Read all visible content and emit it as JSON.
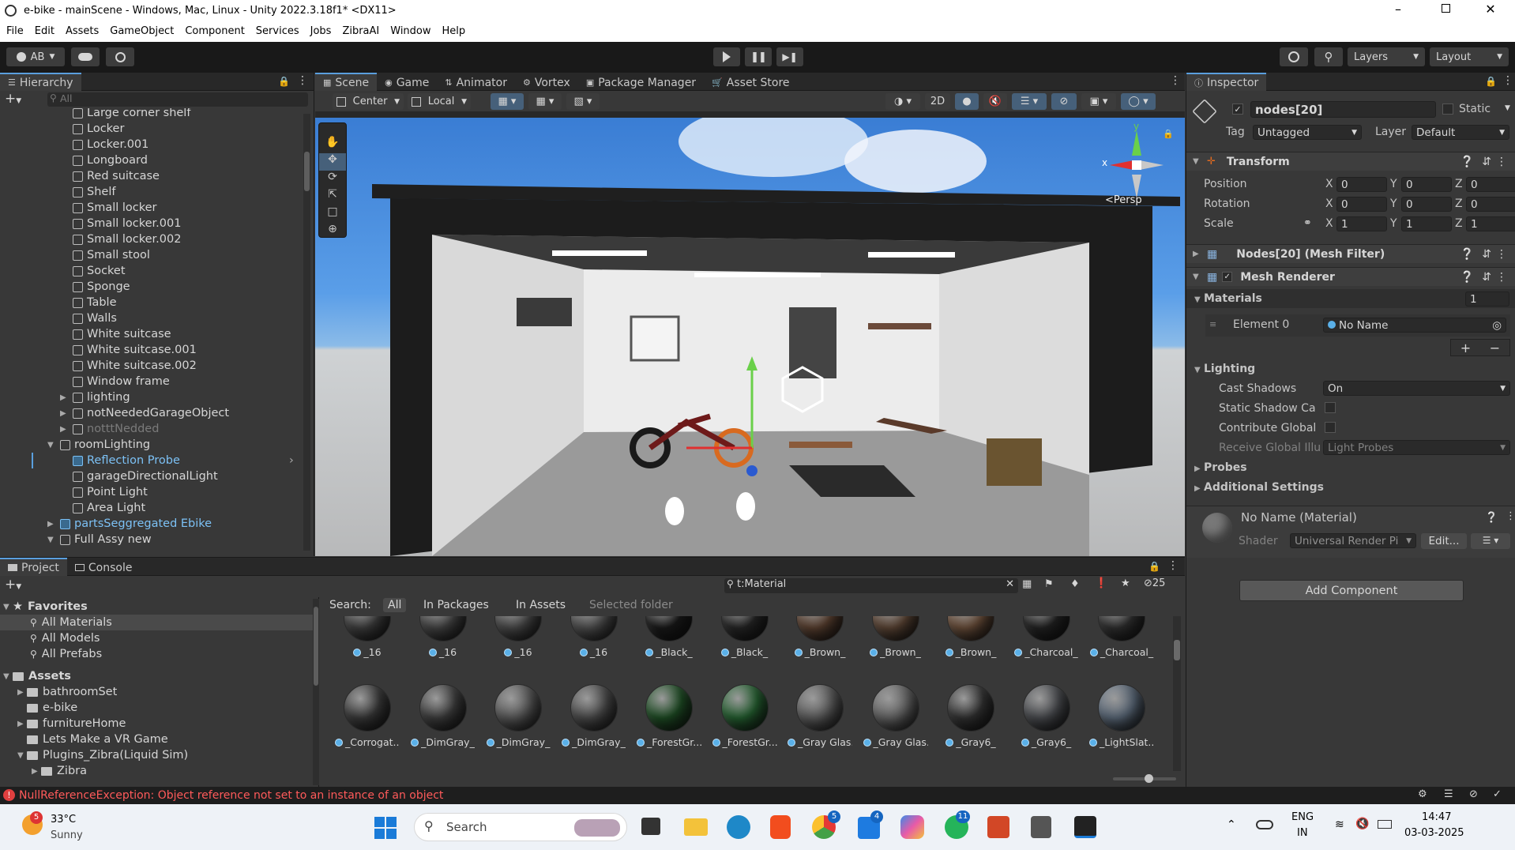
{
  "titlebar": {
    "title": "e-bike - mainScene - Windows, Mac, Linux - Unity 2022.3.18f1* <DX11>"
  },
  "menu": [
    "File",
    "Edit",
    "Assets",
    "GameObject",
    "Component",
    "Services",
    "Jobs",
    "ZibraAI",
    "Window",
    "Help"
  ],
  "toolbar": {
    "account": "AB",
    "layers": "Layers",
    "layout": "Layout"
  },
  "hierarchy": {
    "tab": "Hierarchy",
    "search_placeholder": "All",
    "items": [
      {
        "label": "Large corner shelf",
        "indent": 1,
        "type": "object",
        "state": "normal"
      },
      {
        "label": "Locker",
        "indent": 1,
        "type": "object",
        "state": "normal"
      },
      {
        "label": "Locker.001",
        "indent": 1,
        "type": "object",
        "state": "normal"
      },
      {
        "label": "Longboard",
        "indent": 1,
        "type": "object",
        "state": "normal"
      },
      {
        "label": "Red suitcase",
        "indent": 1,
        "type": "object",
        "state": "normal"
      },
      {
        "label": "Shelf",
        "indent": 1,
        "type": "object",
        "state": "normal"
      },
      {
        "label": "Small locker",
        "indent": 1,
        "type": "object",
        "state": "normal"
      },
      {
        "label": "Small locker.001",
        "indent": 1,
        "type": "object",
        "state": "normal"
      },
      {
        "label": "Small locker.002",
        "indent": 1,
        "type": "object",
        "state": "normal"
      },
      {
        "label": "Small stool",
        "indent": 1,
        "type": "object",
        "state": "normal"
      },
      {
        "label": "Socket",
        "indent": 1,
        "type": "object",
        "state": "normal"
      },
      {
        "label": "Sponge",
        "indent": 1,
        "type": "object",
        "state": "normal"
      },
      {
        "label": "Table",
        "indent": 1,
        "type": "object",
        "state": "normal"
      },
      {
        "label": "Walls",
        "indent": 1,
        "type": "object",
        "state": "normal"
      },
      {
        "label": "White suitcase",
        "indent": 1,
        "type": "object",
        "state": "normal"
      },
      {
        "label": "White suitcase.001",
        "indent": 1,
        "type": "object",
        "state": "normal"
      },
      {
        "label": "White suitcase.002",
        "indent": 1,
        "type": "object",
        "state": "normal"
      },
      {
        "label": "Window frame",
        "indent": 1,
        "type": "object",
        "state": "normal"
      },
      {
        "label": "lighting",
        "indent": 1,
        "type": "object",
        "state": "collapsed"
      },
      {
        "label": "notNeededGarageObject",
        "indent": 1,
        "type": "object",
        "state": "collapsed"
      },
      {
        "label": "notttNedded",
        "indent": 1,
        "type": "object",
        "state": "disabled"
      },
      {
        "label": "roomLighting",
        "indent": 0,
        "type": "object",
        "state": "expanded"
      },
      {
        "label": "Reflection Probe",
        "indent": 1,
        "type": "prefab",
        "state": "prefab"
      },
      {
        "label": "garageDirectionalLight",
        "indent": 1,
        "type": "object",
        "state": "normal"
      },
      {
        "label": "Point Light",
        "indent": 1,
        "type": "object",
        "state": "normal"
      },
      {
        "label": "Area Light",
        "indent": 1,
        "type": "object",
        "state": "normal"
      },
      {
        "label": "partsSeggregated Ebike",
        "indent": 0,
        "type": "prefab",
        "state": "prefab-collapsed"
      },
      {
        "label": "Full Assy new",
        "indent": 0,
        "type": "object",
        "state": "expanded"
      }
    ]
  },
  "scene": {
    "tabs": [
      "Scene",
      "Game",
      "Animator",
      "Vortex",
      "Package Manager",
      "Asset Store"
    ],
    "pivot": "Center",
    "space": "Local",
    "mode_2d": "2D",
    "persp_label": "<Persp",
    "gizmo_axes": {
      "x": "x",
      "y": "y"
    }
  },
  "inspector": {
    "tab": "Inspector",
    "object_name": "nodes[20]",
    "static_label": "Static",
    "tag_label": "Tag",
    "tag_value": "Untagged",
    "layer_label": "Layer",
    "layer_value": "Default",
    "transform": {
      "title": "Transform",
      "rows": [
        {
          "label": "Position",
          "x": "0",
          "y": "0",
          "z": "0"
        },
        {
          "label": "Rotation",
          "x": "0",
          "y": "0",
          "z": "0"
        },
        {
          "label": "Scale",
          "x": "1",
          "y": "1",
          "z": "1"
        }
      ]
    },
    "mesh_filter": "Nodes[20] (Mesh Filter)",
    "mesh_renderer": "Mesh Renderer",
    "materials_label": "Materials",
    "materials_count": "1",
    "element0_label": "Element 0",
    "element0_value": "No Name",
    "lighting_label": "Lighting",
    "cast_shadows_label": "Cast Shadows",
    "cast_shadows_value": "On",
    "static_shadow_label": "Static Shadow Ca",
    "contribute_global_label": "Contribute Global",
    "receive_gi_label": "Receive Global Illu",
    "receive_gi_value": "Light Probes",
    "probes_label": "Probes",
    "additional_label": "Additional Settings",
    "material_name": "No Name (Material)",
    "shader_label": "Shader",
    "shader_value": "Universal Render Pi",
    "edit_button": "Edit...",
    "add_component": "Add Component"
  },
  "project": {
    "tabs": [
      "Project",
      "Console"
    ],
    "search_value": "t:Material",
    "hidden_count": "25",
    "search_label": "Search:",
    "scopes": [
      "All",
      "In Packages",
      "In Assets",
      "Selected folder"
    ],
    "favorites_label": "Favorites",
    "favorites": [
      "All Materials",
      "All Models",
      "All Prefabs"
    ],
    "assets_label": "Assets",
    "folders": [
      "bathroomSet",
      "e-bike",
      "furnitureHome",
      "Lets Make a VR Game",
      "Plugins_Zibra(Liquid Sim)",
      "Zibra"
    ],
    "materials_row1": [
      {
        "label": "_16",
        "color": "#3f3f3f"
      },
      {
        "label": "_16",
        "color": "#454545"
      },
      {
        "label": "_16",
        "color": "#4a4a4a"
      },
      {
        "label": "_16",
        "color": "#505050"
      },
      {
        "label": "_Black_",
        "color": "#1a1a1a"
      },
      {
        "label": "_Black_",
        "color": "#262626"
      },
      {
        "label": "_Brown_",
        "color": "#5a4030"
      },
      {
        "label": "_Brown_",
        "color": "#5c4535"
      },
      {
        "label": "_Brown_",
        "color": "#6a4e3a"
      },
      {
        "label": "_Charcoal_",
        "color": "#232323"
      },
      {
        "label": "_Charcoal_",
        "color": "#303030"
      }
    ],
    "materials_row2": [
      {
        "label": "_Corrogat...",
        "color": "#3a3a3a"
      },
      {
        "label": "_DimGray_",
        "color": "#3e3e3e"
      },
      {
        "label": "_DimGray_",
        "color": "#5a5a5a"
      },
      {
        "label": "_DimGray_",
        "color": "#4c4c4c"
      },
      {
        "label": "_ForestGr...",
        "color": "#1e4d24"
      },
      {
        "label": "_ForestGr...",
        "color": "#246030"
      },
      {
        "label": "_Gray Glas...",
        "color": "#5e5e5e"
      },
      {
        "label": "_Gray Glas...",
        "color": "#666"
      },
      {
        "label": "_Gray6_",
        "color": "#333"
      },
      {
        "label": "_Gray6_",
        "color": "#4a4c50"
      },
      {
        "label": "_LightSlat...",
        "color": "#5a6878"
      }
    ]
  },
  "status": {
    "error": "NullReferenceException: Object reference not set to an instance of an object"
  },
  "taskbar": {
    "temp": "33°C",
    "weather": "Sunny",
    "badge": "5",
    "search": "Search",
    "lang1": "ENG",
    "lang2": "IN",
    "time": "14:47",
    "date": "03-03-2025",
    "badge_chrome": "5",
    "badge_vs": "4",
    "badge_wa": "11"
  },
  "colors": {
    "accent": "#5a9fde",
    "error": "#ff5050",
    "prefab": "#7cc1f5",
    "bg": "#383838"
  }
}
